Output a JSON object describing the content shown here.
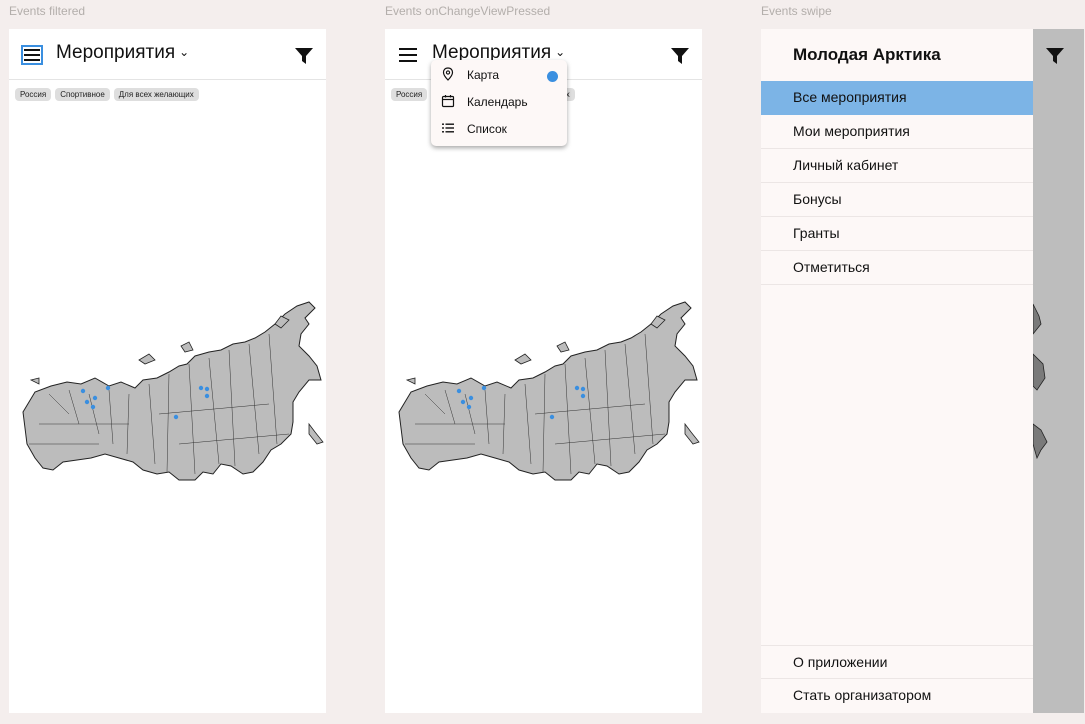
{
  "frames": [
    {
      "label": "Events filtered"
    },
    {
      "label": "Events onChangeViewPressed"
    },
    {
      "label": "Events swipe"
    }
  ],
  "appbar": {
    "title": "Мероприятия"
  },
  "chips": [
    "Россия",
    "Спортивное",
    "Для всех желающих"
  ],
  "view_menu": {
    "items": [
      {
        "label": "Карта",
        "icon": "map-pin-icon",
        "selected": true
      },
      {
        "label": "Календарь",
        "icon": "calendar-icon",
        "selected": false
      },
      {
        "label": "Список",
        "icon": "list-icon",
        "selected": false
      }
    ]
  },
  "drawer": {
    "title": "Молодая Арктика",
    "items": [
      "Все мероприятия",
      "Мои мероприятия",
      "Личный кабинет",
      "Бонусы",
      "Гранты",
      "Отметиться"
    ],
    "bottom_items": [
      "О приложении",
      "Стать организатором"
    ]
  },
  "colors": {
    "accent": "#3a8fe0",
    "drawer_active": "#7cb4e6",
    "map_fill": "#bcbcbc",
    "background": "#f4eeed"
  }
}
